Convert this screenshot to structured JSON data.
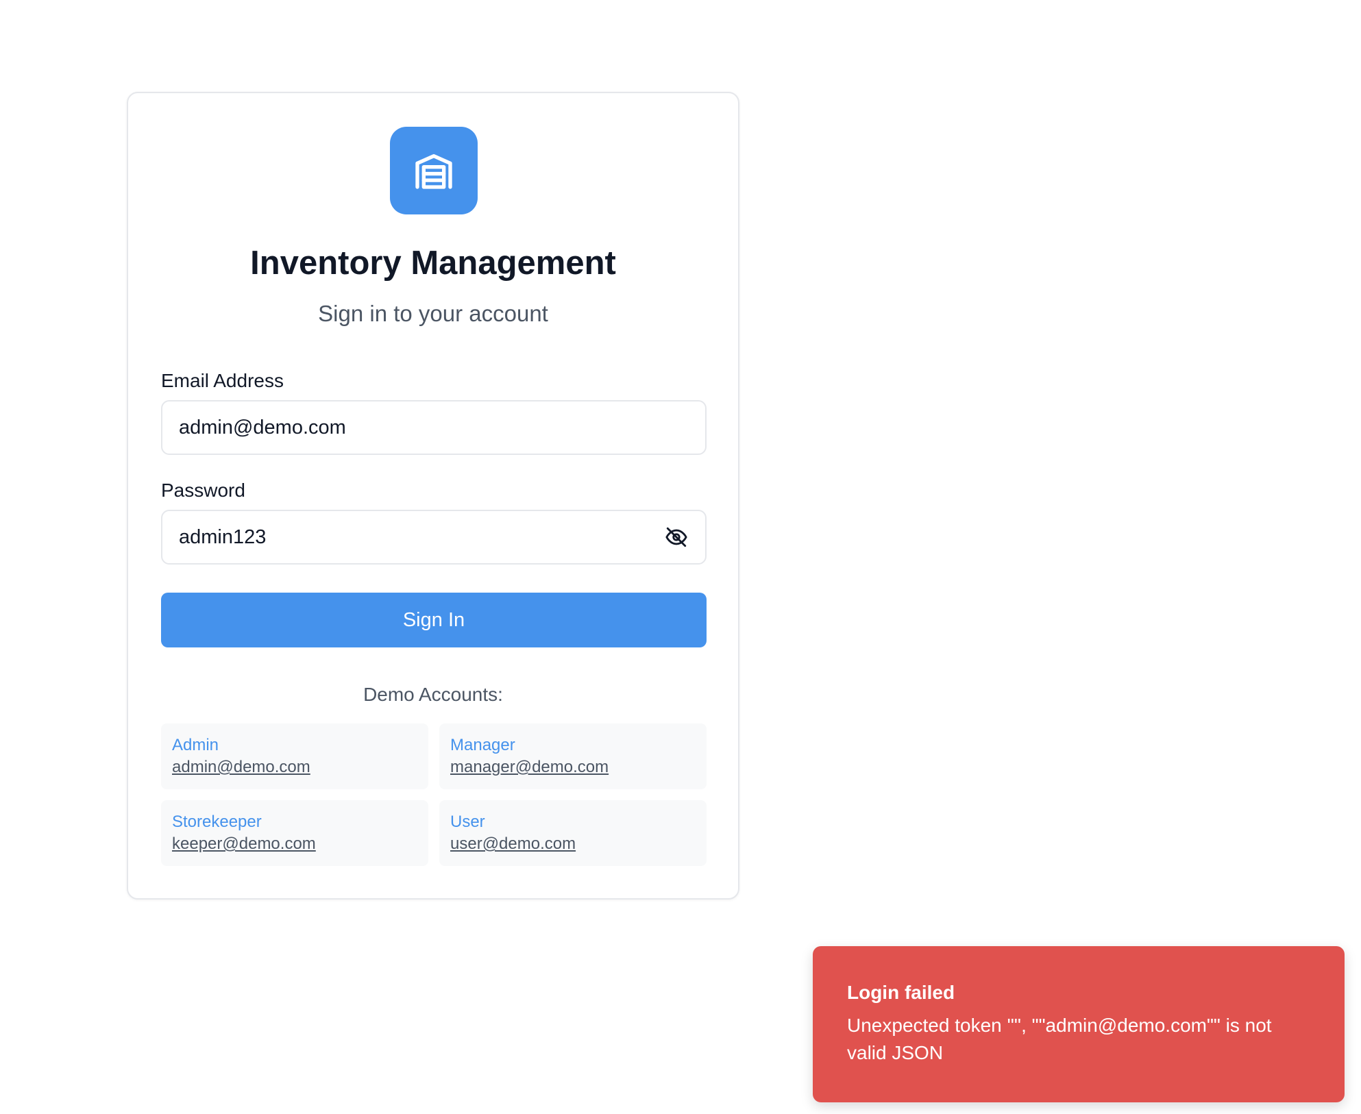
{
  "app": {
    "title": "Inventory Management",
    "subtitle": "Sign in to your account",
    "logo_icon": "warehouse-icon",
    "accent_color": "#4592ec"
  },
  "form": {
    "email_label": "Email Address",
    "email_value": "admin@demo.com",
    "password_label": "Password",
    "password_value": "admin123",
    "password_toggle_icon": "eye-off-icon",
    "submit_label": "Sign In"
  },
  "demo": {
    "title": "Demo Accounts:",
    "accounts": [
      {
        "role": "Admin",
        "email": "admin@demo.com"
      },
      {
        "role": "Manager",
        "email": "manager@demo.com"
      },
      {
        "role": "Storekeeper",
        "email": "keeper@demo.com"
      },
      {
        "role": "User",
        "email": "user@demo.com"
      }
    ]
  },
  "toast": {
    "title": "Login failed",
    "message": "Unexpected token '\"', \"\"admin@demo.com\"\" is not valid JSON",
    "color": "#e0524e"
  }
}
